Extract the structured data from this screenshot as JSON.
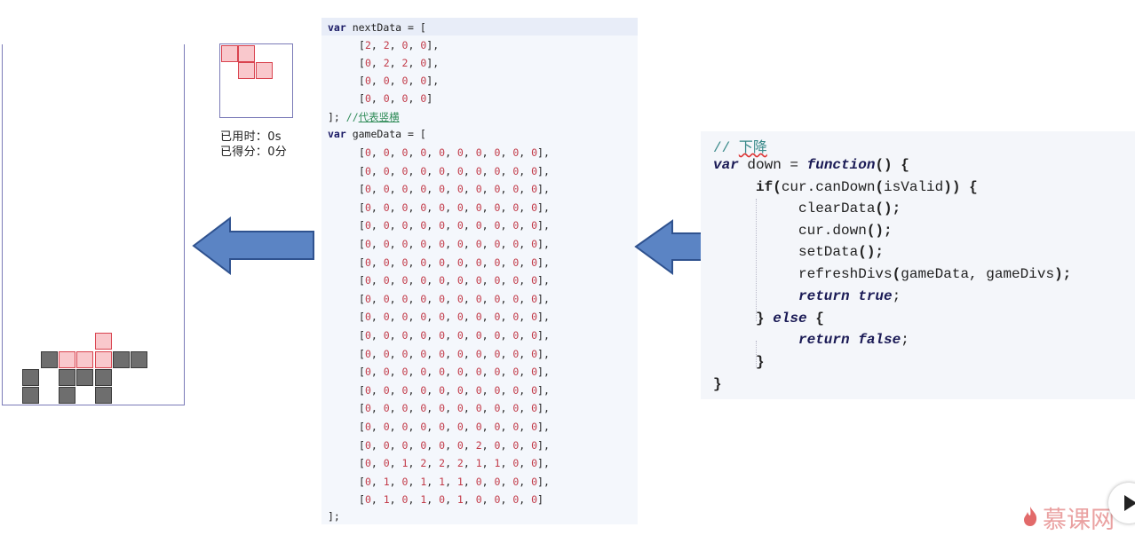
{
  "info": {
    "time_label": "已用时：0s",
    "score_label": "已得分：0分"
  },
  "colors": {
    "fixed_block": "#6e6e6e",
    "active_block": "#f9c8cc",
    "active_border": "#d9434f",
    "arrow_fill": "#5b84c4",
    "arrow_border": "#2f528f",
    "board_border": "#7b7bb8"
  },
  "code_panel": {
    "next_data_header": "var nextData = [",
    "next_data_rows": [
      "[2, 2, 0, 0],",
      "[0, 2, 2, 0],",
      "[0, 0, 0, 0],",
      "[0, 0, 0, 0]"
    ],
    "next_data_footer": "]; //",
    "next_data_comment": "代表竖横",
    "game_data_header": "var gameData = [",
    "game_data_rows": [
      "[0, 0, 0, 0, 0, 0, 0, 0, 0, 0],",
      "[0, 0, 0, 0, 0, 0, 0, 0, 0, 0],",
      "[0, 0, 0, 0, 0, 0, 0, 0, 0, 0],",
      "[0, 0, 0, 0, 0, 0, 0, 0, 0, 0],",
      "[0, 0, 0, 0, 0, 0, 0, 0, 0, 0],",
      "[0, 0, 0, 0, 0, 0, 0, 0, 0, 0],",
      "[0, 0, 0, 0, 0, 0, 0, 0, 0, 0],",
      "[0, 0, 0, 0, 0, 0, 0, 0, 0, 0],",
      "[0, 0, 0, 0, 0, 0, 0, 0, 0, 0],",
      "[0, 0, 0, 0, 0, 0, 0, 0, 0, 0],",
      "[0, 0, 0, 0, 0, 0, 0, 0, 0, 0],",
      "[0, 0, 0, 0, 0, 0, 0, 0, 0, 0],",
      "[0, 0, 0, 0, 0, 0, 0, 0, 0, 0],",
      "[0, 0, 0, 0, 0, 0, 0, 0, 0, 0],",
      "[0, 0, 0, 0, 0, 0, 0, 0, 0, 0],",
      "[0, 0, 0, 0, 0, 0, 0, 0, 0, 0],",
      "[0, 0, 0, 0, 0, 0, 2, 0, 0, 0],",
      "[0, 0, 1, 2, 2, 2, 1, 1, 0, 0],",
      "[0, 1, 0, 1, 1, 1, 0, 0, 0, 0],",
      "[0, 1, 0, 1, 0, 1, 0, 0, 0, 0]"
    ],
    "game_data_footer": "];"
  },
  "down_panel": {
    "comment_prefix": "// ",
    "comment_text": "下降",
    "lines": [
      "var down = function() {",
      "if(cur.canDown(isValid)) {",
      "clearData();",
      "cur.down();",
      "setData();",
      "refreshDivs(gameData, gameDivs);",
      "return true;",
      "} else {",
      "return false;",
      "}",
      "}"
    ]
  },
  "watermark": {
    "text": "慕课网"
  }
}
